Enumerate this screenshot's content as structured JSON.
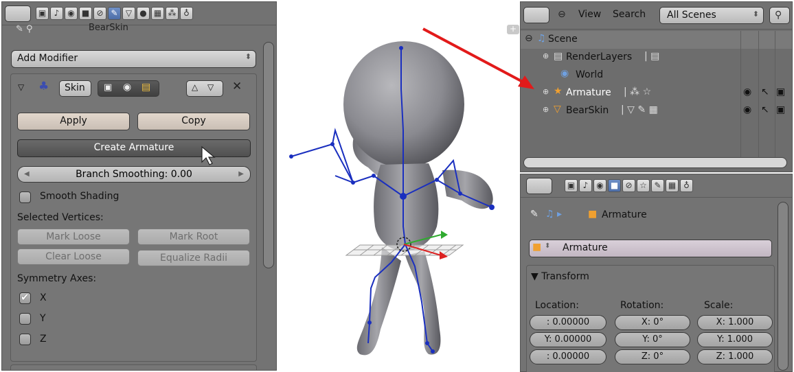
{
  "left_panel": {
    "object_partial": "BearSkin",
    "add_modifier": "Add Modifier",
    "modifier_name": "Skin",
    "apply": "Apply",
    "copy": "Copy",
    "create_armature": "Create Armature",
    "branch_smoothing": "Branch Smoothing: 0.00",
    "smooth_shading": "Smooth Shading",
    "selected_vertices": "Selected Vertices:",
    "mark_loose": "Mark Loose",
    "mark_root": "Mark Root",
    "clear_loose": "Clear Loose",
    "equalize_radii": "Equalize Radii",
    "symmetry_axes": "Symmetry Axes:",
    "axis_x": "X",
    "axis_y": "Y",
    "axis_z": "Z",
    "smooth_shading_checked": false,
    "axis_x_checked": true,
    "axis_y_checked": false,
    "axis_z_checked": false
  },
  "outliner": {
    "menu_view": "View",
    "menu_search": "Search",
    "scenes_select": "All Scenes",
    "items": [
      "Scene",
      "RenderLayers",
      "World",
      "Armature",
      "BearSkin"
    ]
  },
  "properties": {
    "breadcrumb": "Armature",
    "object_name": "Armature",
    "transform": "▼ Transform",
    "location": "Location:",
    "rotation": "Rotation:",
    "scale": "Scale:",
    "loc_x": ": 0.00000",
    "loc_y": "Y: 0.00000",
    "loc_z": ": 0.00000",
    "rot_x": "X: 0°",
    "rot_y": "Y: 0°",
    "rot_z": "Z: 0°",
    "scale_x": "X: 1.000",
    "scale_y": "Y: 1.000",
    "scale_z": "Z: 1.000"
  },
  "colors": {
    "accent_blue": "#5680c2",
    "arrow": "#e21a1a",
    "armature_line": "#1a2fbf"
  }
}
